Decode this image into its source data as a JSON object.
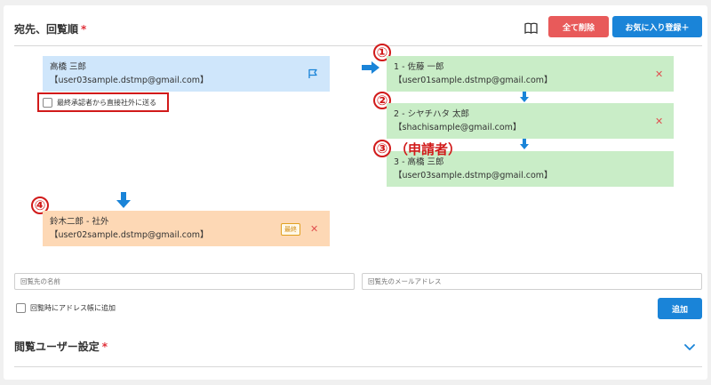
{
  "header": {
    "title": "宛先、回覧順",
    "required_mark": "*",
    "delete_all_label": "全て削除",
    "register_favorite_label": "お気に入り登録＋"
  },
  "left_card": {
    "name": "高橋 三郎",
    "email": "【user03sample.dstmp@gmail.com】"
  },
  "direct_send_checkbox": {
    "label": "最終承認者から直接社外に送る",
    "checked": false
  },
  "route": [
    {
      "marker": "①",
      "name": "1 - 佐藤 一郎",
      "email": "【user01sample.dstmp@gmail.com】"
    },
    {
      "marker": "②",
      "name": "2 - シヤチハタ 太郎",
      "email": "【shachisample@gmail.com】"
    },
    {
      "marker": "③",
      "name": "3 - 高橋 三郎",
      "email": "【user03sample.dstmp@gmail.com】",
      "note": "（申請者）"
    }
  ],
  "final_recipient": {
    "marker": "④",
    "name": "鈴木二郎 - 社外",
    "email": "【user02sample.dstmp@gmail.com】",
    "badge": "最終"
  },
  "add_form": {
    "name_placeholder": "回覧先の名前",
    "email_placeholder": "回覧先のメールアドレス",
    "address_book_label": "回覧時にアドレス帳に追加",
    "add_label": "追加"
  },
  "viewer_section": {
    "title": "閲覧ユーザー設定",
    "required_mark": "*"
  },
  "colors": {
    "accent_blue": "#1a84d8",
    "danger_red": "#e85a5a",
    "annotation_red": "#d11a1a",
    "card_blue": "#cfe6fb",
    "card_green": "#c9edc7",
    "card_orange": "#fdd8b5"
  },
  "icons": {
    "book": "book-icon",
    "flag": "flag-icon",
    "remove": "close-icon",
    "arrow_right": "arrow-right-icon",
    "arrow_down": "arrow-down-icon",
    "chevron": "chevron-down-icon"
  }
}
